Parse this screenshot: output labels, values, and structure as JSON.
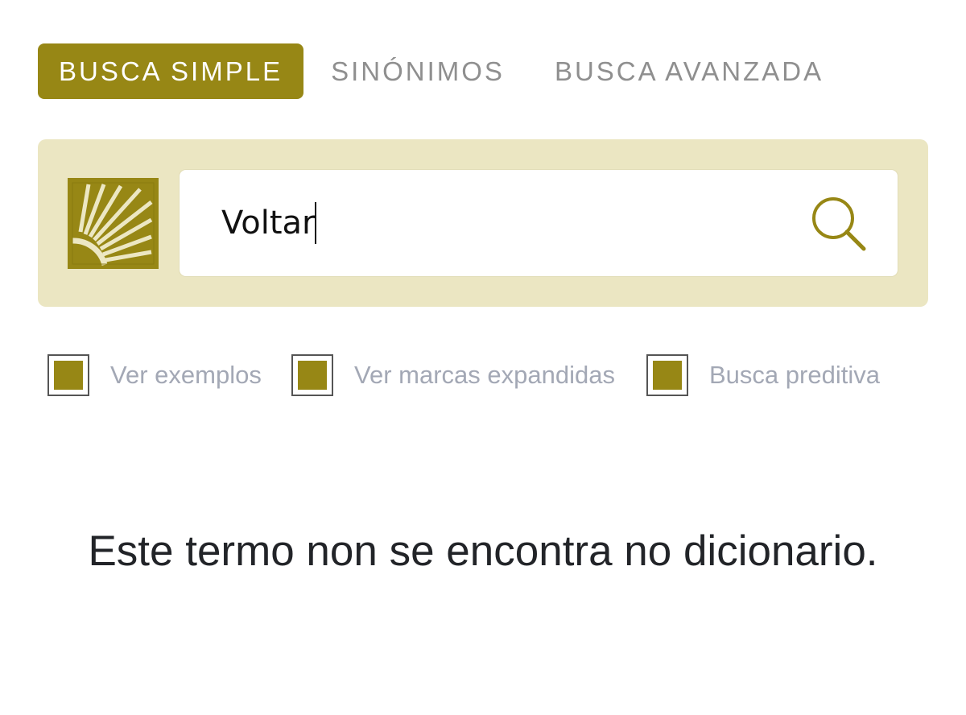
{
  "tabs": [
    {
      "label": "BUSCA SIMPLE",
      "active": true
    },
    {
      "label": "SINÓNIMOS",
      "active": false
    },
    {
      "label": "BUSCA AVANZADA",
      "active": false
    }
  ],
  "search": {
    "value": "Voltar",
    "logo_icon": "sun-rays-logo-icon",
    "button_icon": "search-icon"
  },
  "options": [
    {
      "label": "Ver exemplos",
      "checked": true
    },
    {
      "label": "Ver marcas expandidas",
      "checked": true
    },
    {
      "label": "Busca preditiva",
      "checked": true
    }
  ],
  "result": {
    "message": "Este termo non se encontra no dicionario."
  },
  "colors": {
    "accent": "#978715",
    "panel": "#ebe6c2",
    "tab_inactive": "#8f8f8f",
    "option_text": "#a3a8b5",
    "message_text": "#222428"
  }
}
